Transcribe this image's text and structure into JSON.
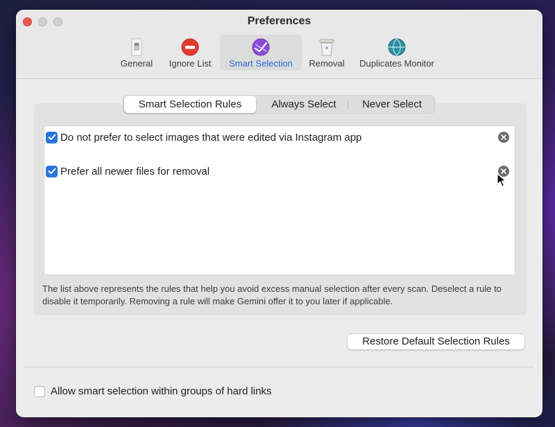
{
  "window": {
    "title": "Preferences"
  },
  "toolbar": {
    "tabs": [
      {
        "label": "General",
        "icon": "switch-icon"
      },
      {
        "label": "Ignore List",
        "icon": "no-entry-icon"
      },
      {
        "label": "Smart Selection",
        "icon": "smart-selection-icon",
        "selected": true
      },
      {
        "label": "Removal",
        "icon": "trash-icon"
      },
      {
        "label": "Duplicates Monitor",
        "icon": "monitor-globe-icon"
      }
    ]
  },
  "segments": {
    "items": [
      "Smart Selection Rules",
      "Always Select",
      "Never Select"
    ],
    "active": "Smart Selection Rules"
  },
  "rules": [
    {
      "label": "Do not prefer to select images that were edited via Instagram app",
      "checked": true
    },
    {
      "label": "Prefer all newer files for removal",
      "checked": true
    }
  ],
  "help_text": "The list above represents the rules that help you avoid excess manual selection after every scan. Deselect a rule to disable it temporarily. Removing a rule will make Gemini offer it to you later if applicable.",
  "restore_button": "Restore Default Selection Rules",
  "hard_links_option": {
    "label": "Allow smart selection within groups of hard links",
    "checked": false
  },
  "colors": {
    "accent": "#2a74e0",
    "close_button": "#ee5a52"
  }
}
